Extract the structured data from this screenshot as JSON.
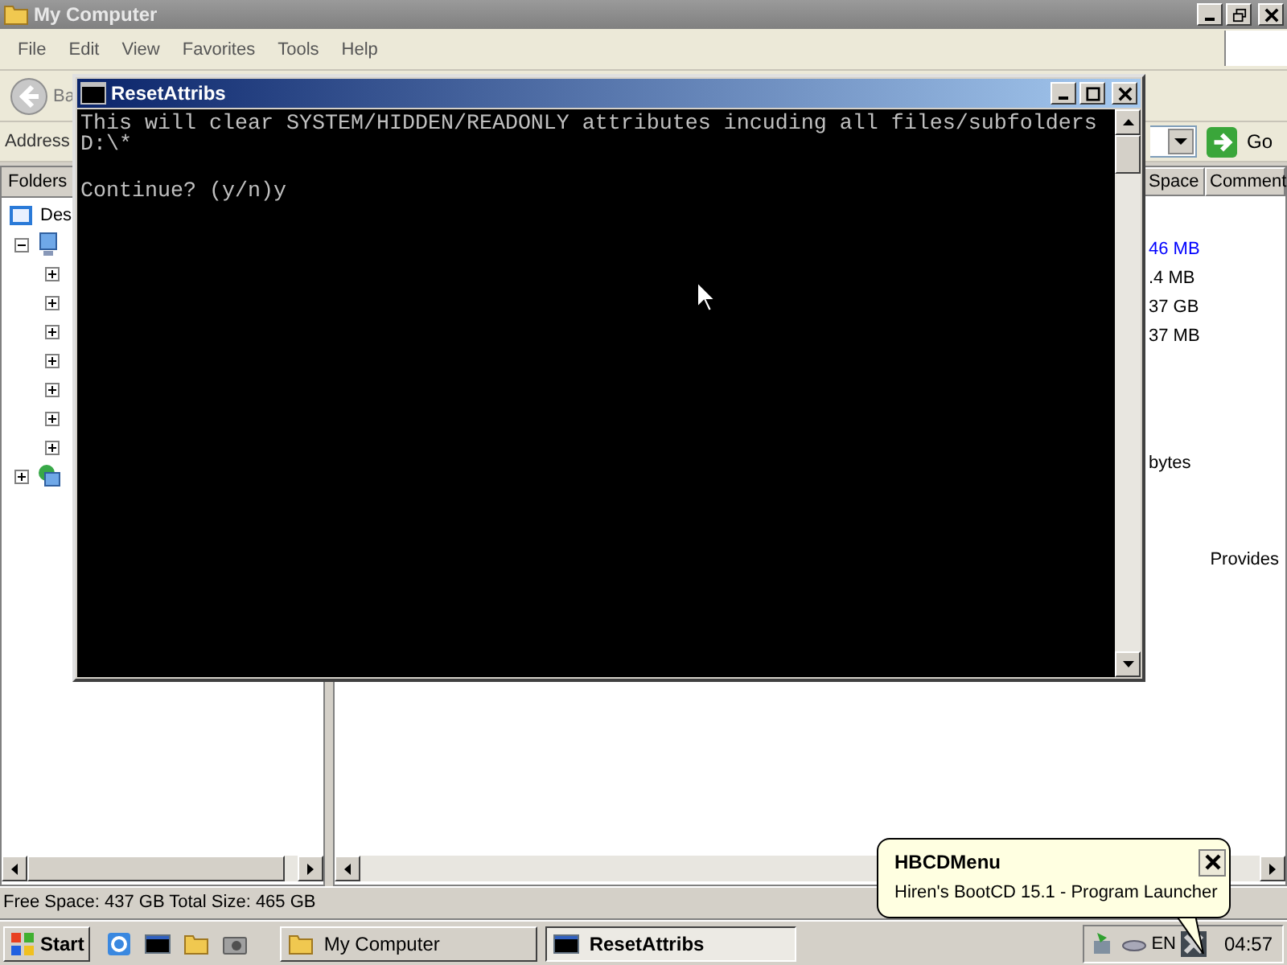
{
  "explorer": {
    "title": "My Computer",
    "menu": [
      "File",
      "Edit",
      "View",
      "Favorites",
      "Tools",
      "Help"
    ],
    "back_label": "Ba",
    "address_label": "Address",
    "go_label": "Go",
    "folders_label": "Folders",
    "tree": [
      {
        "label": "Des",
        "kind": "desktop",
        "children": [
          {
            "kind": "computer",
            "expanded": true,
            "children": [
              {
                "expanded": false
              },
              {
                "expanded": false
              },
              {
                "expanded": false
              },
              {
                "expanded": false
              },
              {
                "expanded": false
              },
              {
                "expanded": false
              },
              {
                "expanded": false
              }
            ]
          },
          {
            "kind": "network",
            "expanded": false
          }
        ]
      }
    ],
    "columns": [
      "Space",
      "Comment"
    ],
    "groups": [
      {
        "rows": [
          {
            "space": "46 MB",
            "color": "#0000ff"
          },
          {
            "space": ".4 MB",
            "color": "#000000"
          },
          {
            "space": "37 GB",
            "color": "#000000"
          },
          {
            "space": "37 MB",
            "color": "#000000"
          }
        ]
      },
      {
        "rows": [
          {
            "space": "bytes",
            "color": "#000000"
          }
        ]
      },
      {
        "rows": [
          {
            "comment": "Provides",
            "color": "#000000"
          }
        ]
      }
    ],
    "status": "Free Space: 437 GB Total Size: 465 GB"
  },
  "console": {
    "title": "ResetAttribs",
    "lines": [
      "This will clear SYSTEM/HIDDEN/READONLY attributes incuding all files/subfolders",
      "D:\\*",
      "Continue? (y/n)y"
    ]
  },
  "taskbar": {
    "start": "Start",
    "quick_launch": [
      {
        "kind": "browser"
      },
      {
        "kind": "console"
      },
      {
        "kind": "folder"
      },
      {
        "kind": "camera"
      }
    ],
    "tasks": [
      {
        "label": "My Computer",
        "kind": "folder",
        "selected": false
      },
      {
        "label": "ResetAttribs",
        "kind": "console",
        "selected": true
      }
    ],
    "language": "EN",
    "clock": "04:57"
  },
  "balloon": {
    "title": "HBCDMenu",
    "text": "Hiren's BootCD 15.1 - Program Launcher"
  }
}
